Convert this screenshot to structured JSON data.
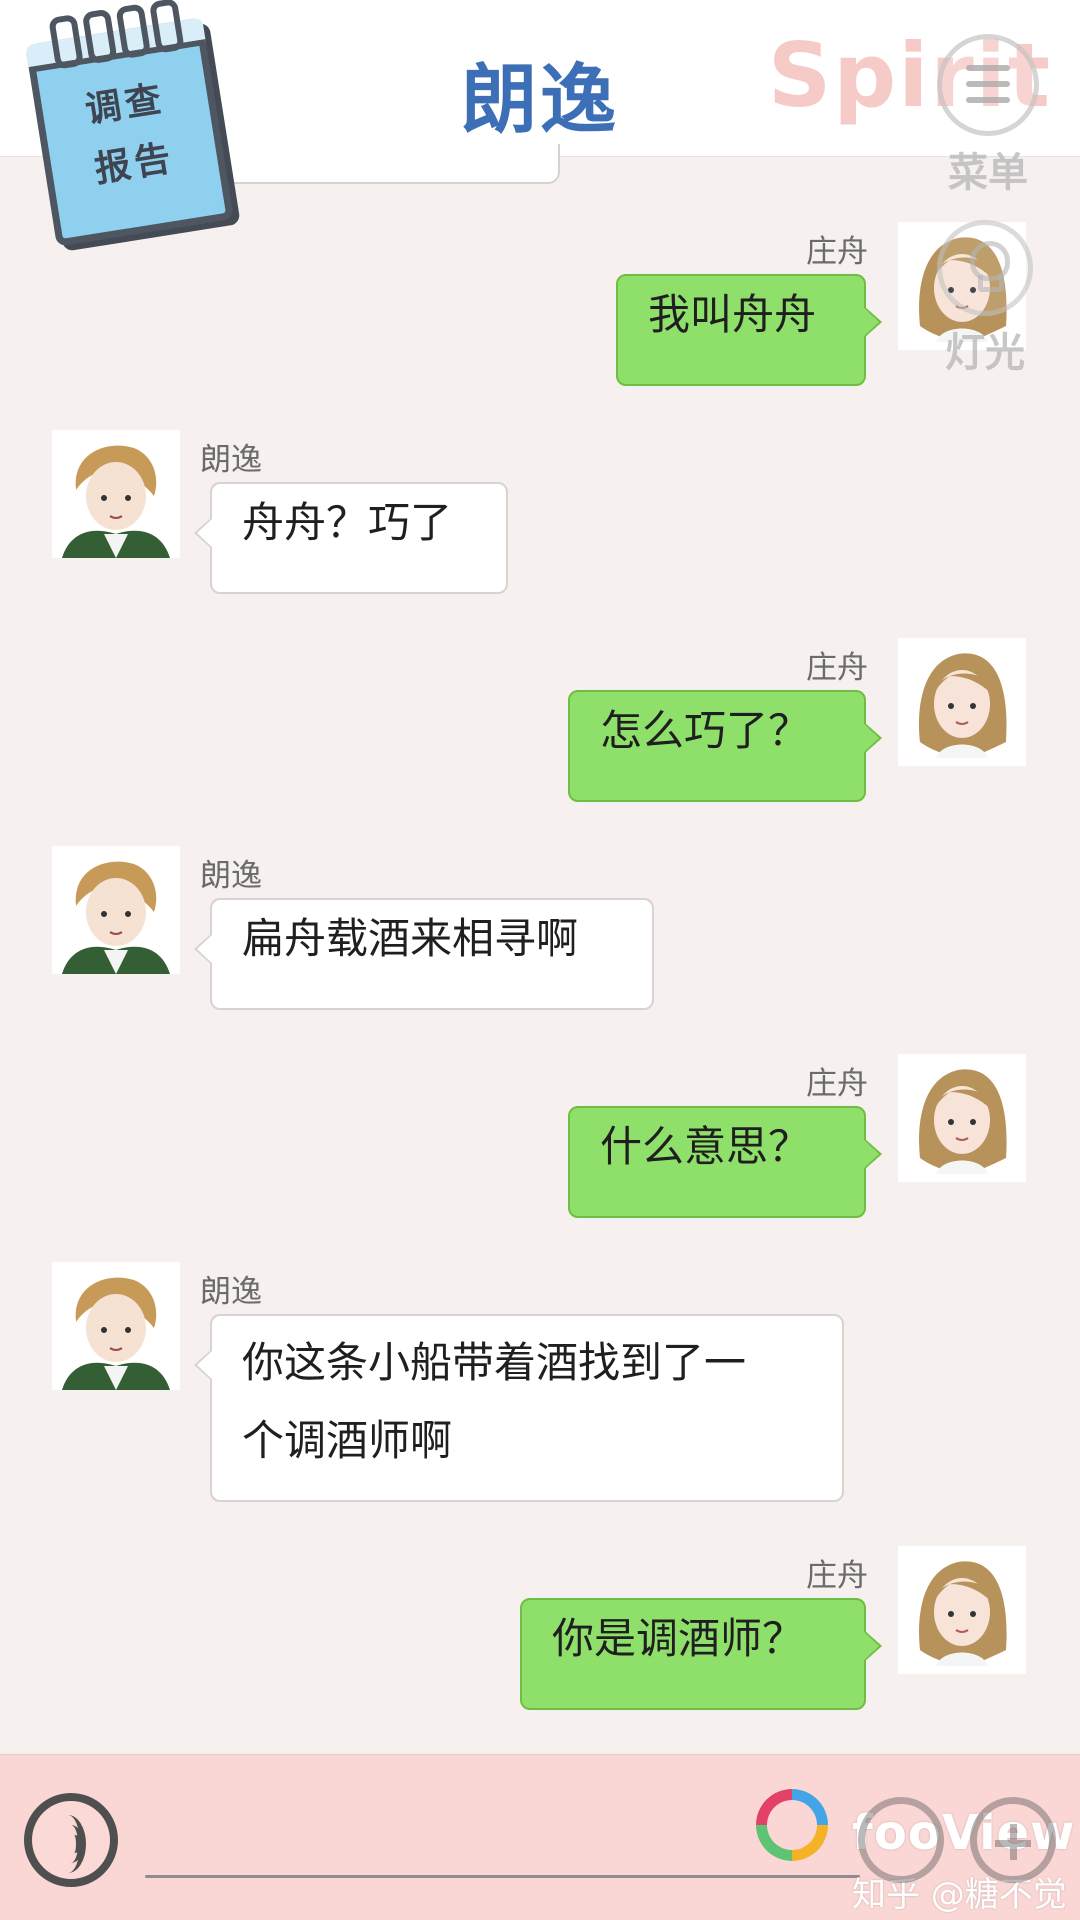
{
  "header": {
    "title": "朗逸",
    "brand": "Spirit",
    "report_line1": "调查",
    "report_line2": "报告",
    "menu_label": "菜单",
    "light_label": "灯光"
  },
  "chat": {
    "messages": [
      {
        "side": "right",
        "name": "庄舟",
        "text": "我叫舟舟"
      },
      {
        "side": "left",
        "name": "朗逸",
        "text": "舟舟？巧了"
      },
      {
        "side": "right",
        "name": "庄舟",
        "text": "怎么巧了？"
      },
      {
        "side": "left",
        "name": "朗逸",
        "text": "扁舟载酒来相寻啊"
      },
      {
        "side": "right",
        "name": "庄舟",
        "text": "什么意思？"
      },
      {
        "side": "left",
        "name": "朗逸",
        "text": "你这条小船带着酒找到了一\n个调酒师啊"
      },
      {
        "side": "right",
        "name": "庄舟",
        "text": "你是调酒师？"
      }
    ]
  },
  "bottom_bar": {
    "watermark_app": "fooView",
    "watermark_user": "知乎 @糖不觉"
  },
  "colors": {
    "title": "#3c6fb6",
    "bubble_green": "#8fe06a",
    "bubble_white": "#ffffff",
    "background": "#f6f0ee",
    "bottom_bar": "#fad7d5"
  },
  "icons": {
    "report": "notepad-icon",
    "menu": "menu-icon",
    "light": "lightbulb-icon",
    "voice": "voice-icon",
    "emoji": "emoji-icon",
    "plus": "plus-icon",
    "foo_logo": "fooview-logo-icon"
  }
}
